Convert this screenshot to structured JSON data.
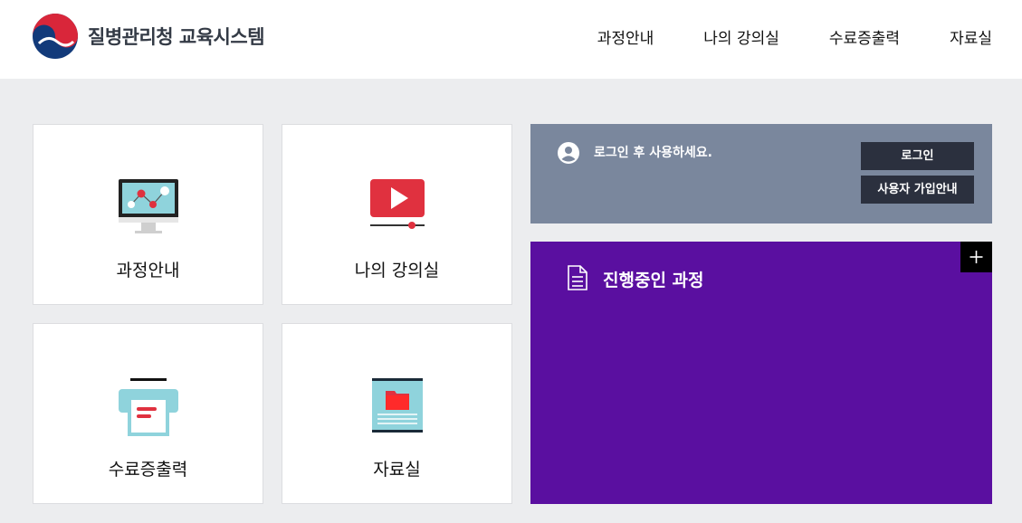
{
  "header": {
    "logo_text": "질병관리청 교육시스템",
    "nav": [
      "과정안내",
      "나의 강의실",
      "수료증출력",
      "자료실"
    ]
  },
  "tiles": [
    {
      "label": "과정안내",
      "icon": "monitor-chart-icon"
    },
    {
      "label": "나의 강의실",
      "icon": "video-play-icon"
    },
    {
      "label": "수료증출력",
      "icon": "printer-icon"
    },
    {
      "label": "자료실",
      "icon": "folder-archive-icon"
    }
  ],
  "login": {
    "message": "로그인 후 사용하세요.",
    "login_button": "로그인",
    "signup_button": "사용자 가입안내"
  },
  "courses": {
    "title": "진행중인 과정",
    "more_label": "+"
  },
  "colors": {
    "background": "#ecedef",
    "login_panel": "#7a879d",
    "button_dark": "#2b303e",
    "course_panel": "#5a0fa0",
    "accent_red": "#e0313f",
    "accent_cyan": "#8fd3dc"
  }
}
